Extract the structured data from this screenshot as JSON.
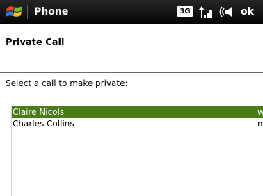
{
  "titlebar": {
    "app_title": "Phone",
    "network_badge": "3G",
    "ok_label": "ok",
    "icons": [
      "windows-logo-icon",
      "signal-icon",
      "speaker-icon"
    ]
  },
  "dialog": {
    "title": "Private Call",
    "instruction": "Select a call to make private:"
  },
  "calls": [
    {
      "name": "Claire Nicols",
      "status": "w",
      "selected": true
    },
    {
      "name": "Charles Collins",
      "status": "m",
      "selected": false
    }
  ],
  "colors": {
    "titlebar_bg": "#101010",
    "selection_bg": "#4a7c1a"
  }
}
